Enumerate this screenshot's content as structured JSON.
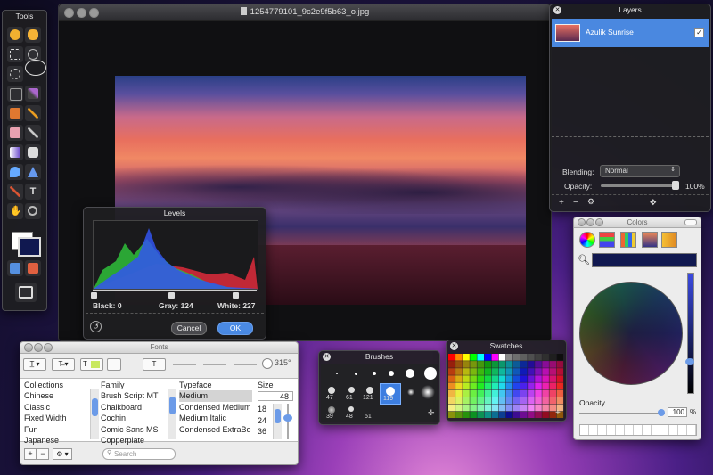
{
  "document": {
    "filename": "1254779101_9c2e9f5b63_o.jpg"
  },
  "tools": {
    "title": "Tools"
  },
  "layers": {
    "title": "Layers",
    "layer_name": "Azulik Sunrise",
    "blending_label": "Blending:",
    "blending_value": "Normal",
    "opacity_label": "Opacity:",
    "opacity_value": "100%",
    "opacity_fraction": 1.0
  },
  "levels": {
    "title": "Levels",
    "black_label": "Black: 0",
    "gray_label": "Gray: 124",
    "white_label": "White: 227",
    "cancel": "Cancel",
    "ok": "OK",
    "colors": {
      "red": "#d42a3a",
      "green": "#2fbf3a",
      "blue": "#3355ee"
    }
  },
  "fonts": {
    "title": "Fonts",
    "collections_header": "Collections",
    "family_header": "Family",
    "typeface_header": "Typeface",
    "size_header": "Size",
    "size_value": "48",
    "angle": "315°",
    "collections": [
      "Chinese",
      "Classic",
      "Fixed Width",
      "Fun",
      "Japanese"
    ],
    "families": [
      "Brush Script MT",
      "Chalkboard",
      "Cochin",
      "Comic Sans MS",
      "Copperplate"
    ],
    "typefaces": [
      "Medium",
      "Condensed Medium",
      "Medium Italic",
      "Condensed ExtraBo"
    ],
    "sizes": [
      "18",
      "24",
      "36"
    ],
    "search_placeholder": "Search",
    "plus": "+",
    "minus": "−"
  },
  "brushes": {
    "title": "Brushes",
    "labels": [
      "47",
      "61",
      "121",
      "119",
      "39",
      "48",
      "51"
    ],
    "selected": "119"
  },
  "swatches": {
    "title": "Swatches",
    "plus": "+"
  },
  "colors": {
    "title": "Colors",
    "current_color": "#101850",
    "opacity_label": "Opacity",
    "opacity_value": "100",
    "percent": "%",
    "opacity_fraction": 1.0
  }
}
